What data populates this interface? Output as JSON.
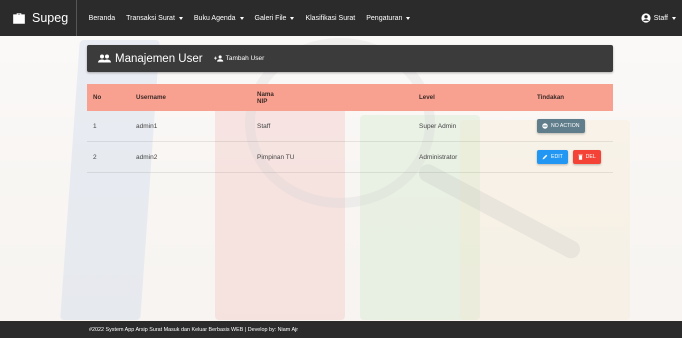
{
  "navbar": {
    "brand": "Supeg",
    "items": [
      {
        "label": "Beranda",
        "dropdown": false
      },
      {
        "label": "Transaksi Surat",
        "dropdown": true
      },
      {
        "label": "Buku Agenda",
        "dropdown": true
      },
      {
        "label": "Galeri File",
        "dropdown": true
      },
      {
        "label": "Klasifikasi Surat",
        "dropdown": false
      },
      {
        "label": "Pengaturan",
        "dropdown": true
      }
    ],
    "user_label": "Staff",
    "icons": {
      "brand": "briefcase-icon",
      "user": "account-circle-icon"
    }
  },
  "panel": {
    "title": "Manajemen User",
    "add_user_label": "Tambah User",
    "icons": {
      "title": "people-icon",
      "add": "person-add-icon"
    }
  },
  "table": {
    "headers": {
      "no": "No",
      "username": "Username",
      "nama": "Nama",
      "nip": "NIP",
      "level": "Level",
      "tindakan": "Tindakan"
    },
    "rows": [
      {
        "no": "1",
        "username": "admin1",
        "nama": "Staff",
        "level": "Super Admin",
        "actions": [
          "NO ACTION"
        ]
      },
      {
        "no": "2",
        "username": "admin2",
        "nama": "Pimpinan TU",
        "level": "Administrator",
        "actions": [
          "EDIT",
          "DEL"
        ]
      }
    ]
  },
  "footer": {
    "text": "#2022 System App Arsip Surat Masuk dan Keluar Berbasis WEB | Develop by: Niam Ajr"
  },
  "colors": {
    "navbar_bg": "#2b2b2b",
    "table_header_bg": "#f9a190",
    "no_action": "#607d8b",
    "edit": "#2196f3",
    "delete": "#f44336"
  }
}
